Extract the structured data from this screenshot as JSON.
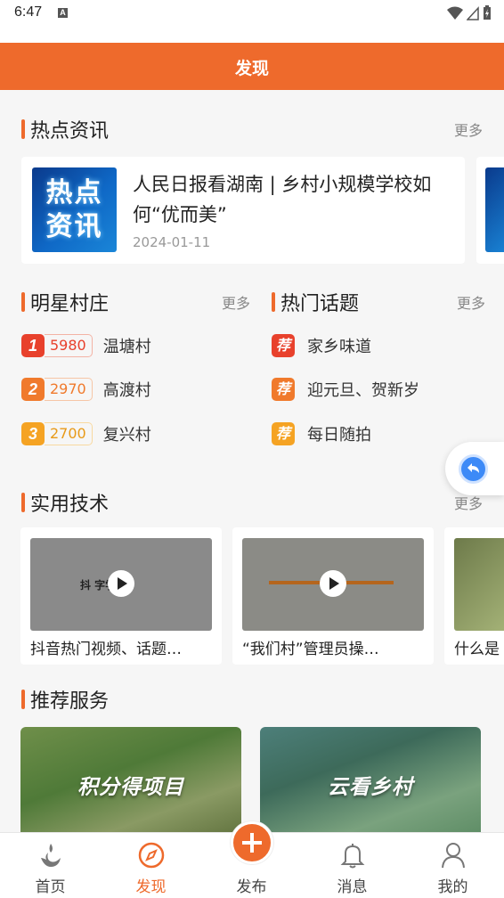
{
  "status_bar": {
    "time": "6:47",
    "notif_icon_letter": "A"
  },
  "header": {
    "title": "发现"
  },
  "hot_news": {
    "title": "热点资讯",
    "more": "更多",
    "thumb_text": "热点\n资讯",
    "item": {
      "title": "人民日报看湖南 | 乡村小规模学校如何“优而美”",
      "date": "2024-01-11"
    }
  },
  "star_villages": {
    "title": "明星村庄",
    "more": "更多",
    "items": [
      {
        "rank": "1",
        "score": "5980",
        "name": "温塘村",
        "color": "#e8412c"
      },
      {
        "rank": "2",
        "score": "2970",
        "name": "高渡村",
        "color": "#f07a2c"
      },
      {
        "rank": "3",
        "score": "2700",
        "name": "复兴村",
        "color": "#f5a323"
      }
    ]
  },
  "hot_topics": {
    "title": "热门话题",
    "more": "更多",
    "badge": "荐",
    "items": [
      {
        "name": "家乡味道",
        "color": "#e8412c"
      },
      {
        "name": "迎元旦、贺新岁",
        "color": "#f07a2c"
      },
      {
        "name": "每日随拍",
        "color": "#f5a323"
      }
    ]
  },
  "tech": {
    "title": "实用技术",
    "more": "更多",
    "videos": [
      {
        "caption": "抖音热门视频、话题…",
        "thumb_text": "抖 字学堂"
      },
      {
        "caption": "“我们村”管理员操…",
        "thumb_text": ""
      },
      {
        "caption": "什么是",
        "thumb_text": ""
      }
    ]
  },
  "services": {
    "title": "推荐服务",
    "items": [
      {
        "label": "积分得项目"
      },
      {
        "label": "云看乡村"
      }
    ]
  },
  "bottom_nav": {
    "items": [
      {
        "label": "首页",
        "icon": "home-flame-icon"
      },
      {
        "label": "发现",
        "icon": "compass-icon",
        "active": true
      },
      {
        "label": "发布",
        "icon": "plus-icon"
      },
      {
        "label": "消息",
        "icon": "bell-icon"
      },
      {
        "label": "我的",
        "icon": "user-icon"
      }
    ]
  },
  "colors": {
    "brand": "#ee6a2c",
    "float_button": "#3d8af7"
  }
}
